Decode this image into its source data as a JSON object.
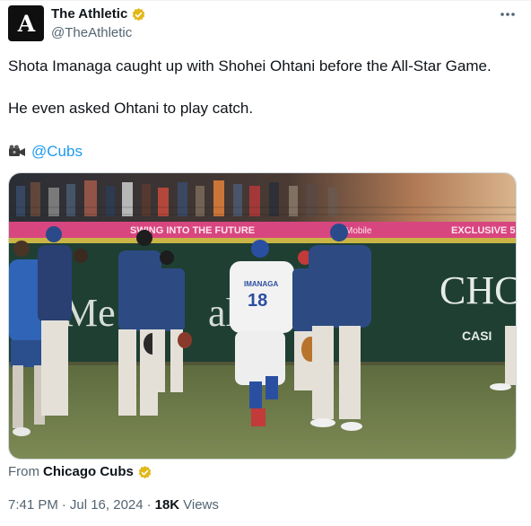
{
  "author": {
    "display_name": "The Athletic",
    "handle": "@TheAthletic",
    "avatar_letter": "A"
  },
  "tweet": {
    "line1": "Shota Imanaga caught up with Shohei Ohtani before the All-Star Game.",
    "line2": "He even asked Ohtani to play catch.",
    "mention_icon": "video-camera-emoji",
    "mention": "@Cubs"
  },
  "media": {
    "banner_left": "SWING INTO THE FUTURE",
    "banner_mid": "Mobile",
    "banner_right": "EXCLUSIVE 5",
    "wall_text_left": "Me",
    "wall_text_mid": "al",
    "wall_text_right": "CHC",
    "wall_text_small": "CASI",
    "jersey_name": "IMANAGA",
    "jersey_number": "18"
  },
  "source": {
    "label": "From",
    "name": "Chicago Cubs"
  },
  "meta": {
    "time": "7:41 PM",
    "sep1": "·",
    "date": "Jul 16, 2024",
    "sep2": "·",
    "views_count": "18K",
    "views_label": "Views"
  },
  "colors": {
    "link": "#1d9bf0",
    "verified_gold": "#e2b719",
    "secondary_text": "#536471",
    "outfield_wall": "#1f3f33",
    "banner": "#d8467f",
    "grass": "#6f7d4a"
  }
}
